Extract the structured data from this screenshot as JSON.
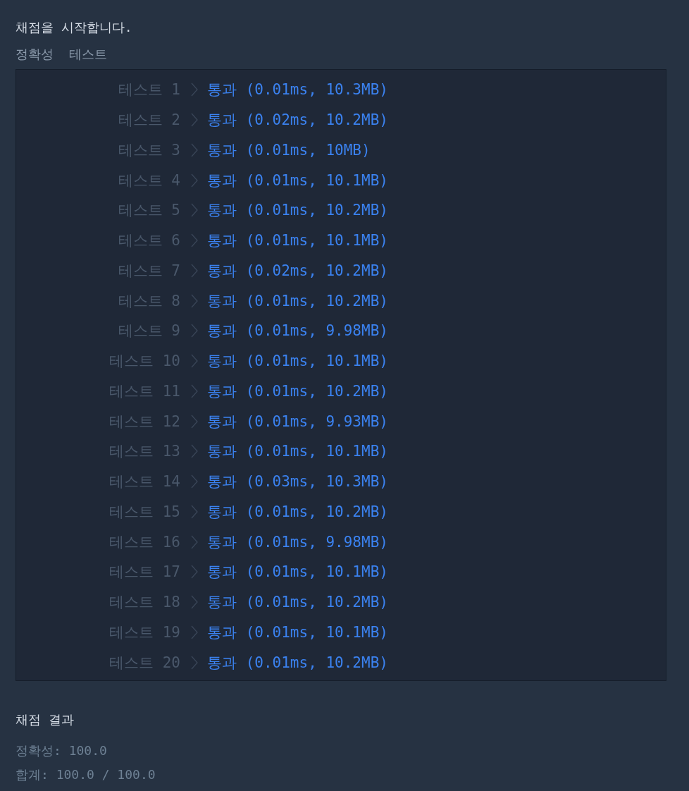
{
  "heading": "채점을 시작합니다.",
  "section_title": "정확성  테스트",
  "tests": [
    {
      "label": "테스트 1",
      "result": "통과 (0.01ms, 10.3MB)"
    },
    {
      "label": "테스트 2",
      "result": "통과 (0.02ms, 10.2MB)"
    },
    {
      "label": "테스트 3",
      "result": "통과 (0.01ms, 10MB)"
    },
    {
      "label": "테스트 4",
      "result": "통과 (0.01ms, 10.1MB)"
    },
    {
      "label": "테스트 5",
      "result": "통과 (0.01ms, 10.2MB)"
    },
    {
      "label": "테스트 6",
      "result": "통과 (0.01ms, 10.1MB)"
    },
    {
      "label": "테스트 7",
      "result": "통과 (0.02ms, 10.2MB)"
    },
    {
      "label": "테스트 8",
      "result": "통과 (0.01ms, 10.2MB)"
    },
    {
      "label": "테스트 9",
      "result": "통과 (0.01ms, 9.98MB)"
    },
    {
      "label": "테스트 10",
      "result": "통과 (0.01ms, 10.1MB)"
    },
    {
      "label": "테스트 11",
      "result": "통과 (0.01ms, 10.2MB)"
    },
    {
      "label": "테스트 12",
      "result": "통과 (0.01ms, 9.93MB)"
    },
    {
      "label": "테스트 13",
      "result": "통과 (0.01ms, 10.1MB)"
    },
    {
      "label": "테스트 14",
      "result": "통과 (0.03ms, 10.3MB)"
    },
    {
      "label": "테스트 15",
      "result": "통과 (0.01ms, 10.2MB)"
    },
    {
      "label": "테스트 16",
      "result": "통과 (0.01ms, 9.98MB)"
    },
    {
      "label": "테스트 17",
      "result": "통과 (0.01ms, 10.1MB)"
    },
    {
      "label": "테스트 18",
      "result": "통과 (0.01ms, 10.2MB)"
    },
    {
      "label": "테스트 19",
      "result": "통과 (0.01ms, 10.1MB)"
    },
    {
      "label": "테스트 20",
      "result": "통과 (0.01ms, 10.2MB)"
    }
  ],
  "summary": {
    "title": "채점 결과",
    "lines": [
      "정확성: 100.0",
      "합계: 100.0 / 100.0"
    ]
  }
}
